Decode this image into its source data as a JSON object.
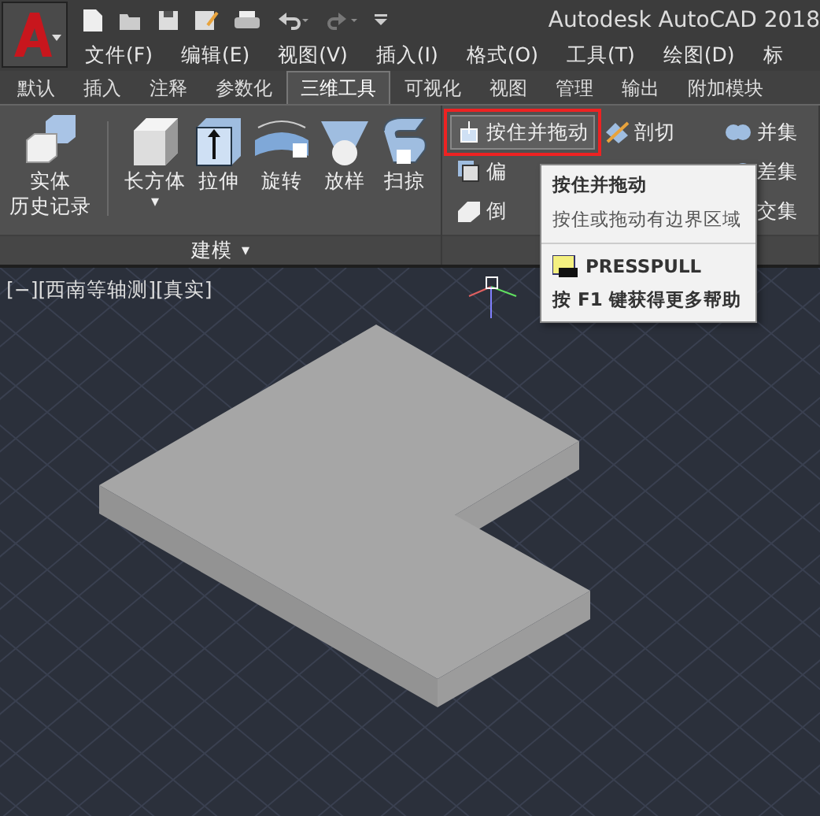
{
  "title_bar": {
    "title": "Autodesk AutoCAD 2018"
  },
  "menu": [
    "文件(F)",
    "编辑(E)",
    "视图(V)",
    "插入(I)",
    "格式(O)",
    "工具(T)",
    "绘图(D)",
    "标"
  ],
  "tabs": [
    {
      "label": "默认",
      "selected": false
    },
    {
      "label": "插入",
      "selected": false
    },
    {
      "label": "注释",
      "selected": false
    },
    {
      "label": "参数化",
      "selected": false
    },
    {
      "label": "三维工具",
      "selected": true
    },
    {
      "label": "可视化",
      "selected": false
    },
    {
      "label": "视图",
      "selected": false
    },
    {
      "label": "管理",
      "selected": false
    },
    {
      "label": "输出",
      "selected": false
    },
    {
      "label": "附加模块",
      "selected": false
    }
  ],
  "modeling_panel": {
    "history_button": [
      "实体",
      "历史记录"
    ],
    "tools": [
      {
        "kind": "box",
        "label": "长方体",
        "dropdown": "▾"
      },
      {
        "kind": "extrude",
        "label": "拉伸"
      },
      {
        "kind": "revolve",
        "label": "旋转"
      },
      {
        "kind": "loft",
        "label": "放样"
      },
      {
        "kind": "sweep",
        "label": "扫掠"
      }
    ],
    "title": "建模",
    "title_caret": "▾"
  },
  "edit_panel": {
    "columns": [
      [
        {
          "kind": "presspull",
          "label": "按住并拖动",
          "highlighted": true
        },
        {
          "kind": "offset",
          "label": "偏",
          "highlighted": false
        },
        {
          "kind": "chamfer",
          "label": "倒",
          "highlighted": false
        }
      ],
      [
        {
          "kind": "slice",
          "label": "剖切",
          "highlighted": false
        }
      ],
      [
        {
          "kind": "union",
          "label": "并集",
          "highlighted": false
        },
        {
          "kind": "subtract",
          "label": "差集",
          "highlighted": false
        },
        {
          "kind": "intersect",
          "label": "交集",
          "highlighted": false
        }
      ]
    ]
  },
  "viewport": {
    "label": "[−][西南等轴测][真实]"
  },
  "tooltip": {
    "title": "按住并拖动",
    "description": "按住或拖动有边界区域",
    "command": "PRESSPULL",
    "help": "按 F1 键获得更多帮助"
  }
}
